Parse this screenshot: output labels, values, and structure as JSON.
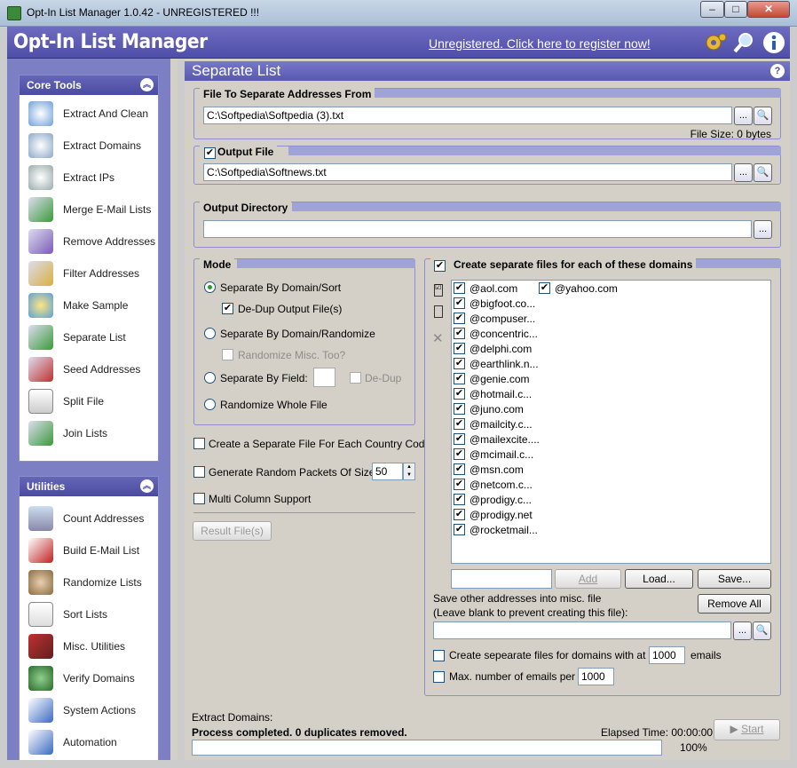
{
  "window": {
    "title": "Opt-In List Manager 1.0.42 - UNREGISTERED !!!",
    "min": "–",
    "max": "□",
    "close": "✕"
  },
  "banner": {
    "logo": "Opt-In List Manager",
    "register_link": "Unregistered. Click here to register now!"
  },
  "sidebar": {
    "core_tools": {
      "title": "Core Tools",
      "items": [
        "Extract And Clean",
        "Extract Domains",
        "Extract IPs",
        "Merge E-Mail Lists",
        "Remove Addresses",
        "Filter Addresses",
        "Make Sample",
        "Separate List",
        "Seed Addresses",
        "Split File",
        "Join Lists"
      ]
    },
    "utilities": {
      "title": "Utilities",
      "items": [
        "Count Addresses",
        "Build E-Mail List",
        "Randomize Lists",
        "Sort Lists",
        "Misc. Utilities",
        "Verify Domains",
        "System Actions",
        "Automation"
      ]
    }
  },
  "main": {
    "title": "Separate List",
    "help": "?",
    "file_group": {
      "title": "File To Separate Addresses From",
      "value": "C:\\Softpedia\\Softpedia (3).txt",
      "file_size": "File Size: 0 bytes"
    },
    "output_group": {
      "title": "Output File",
      "value": "C:\\Softpedia\\Softnews.txt"
    },
    "outdir_group": {
      "title": "Output Directory",
      "value": ""
    },
    "browse": "...",
    "mode": {
      "title": "Mode",
      "opt1": "Separate By Domain/Sort",
      "dedup": "De-Dup Output File(s)",
      "opt2": "Separate By Domain/Randomize",
      "randomize_misc": "Randomize Misc. Too?",
      "opt3": "Separate By Field:",
      "field_dedup": "De-Dup",
      "opt4": "Randomize Whole File"
    },
    "country_code": "Create a Separate File For Each Country Code",
    "random_packets": "Generate Random Packets Of Size",
    "packet_size": "50",
    "multi_column": "Multi Column Support",
    "result_button": "Result File(s)",
    "domains": {
      "title": "Create separate files for each of these domains",
      "list": [
        "@aol.com",
        "@bigfoot.co...",
        "@compuser...",
        "@concentric...",
        "@delphi.com",
        "@earthlink.n...",
        "@genie.com",
        "@hotmail.c...",
        "@juno.com",
        "@mailcity.c...",
        "@mailexcite....",
        "@mcimail.c...",
        "@msn.com",
        "@netcom.c...",
        "@prodigy.c...",
        "@prodigy.net",
        "@rocketmail..."
      ],
      "col2": [
        "@yahoo.com"
      ],
      "add": "Add",
      "load": "Load...",
      "save": "Save...",
      "remove_all": "Remove All",
      "misc_label1": "Save other addresses into misc. file",
      "misc_label2": "(Leave blank to prevent creating this file):",
      "at_least_label": "Create sepearate files for domains with at least",
      "at_least_value": "1000",
      "emails": "emails",
      "max_label": "Max. number of emails per file",
      "max_value": "1000"
    },
    "status": {
      "label": "Extract Domains:",
      "message": "Process completed. 0 duplicates removed.",
      "elapsed": "Elapsed Time:  00:00:00",
      "percent": "100%",
      "progress": 1.0,
      "start": "Start"
    }
  },
  "colors": {
    "banner": "#5c5bb3",
    "sidebar": "#7c7fc4",
    "accent": "#4a4aa0"
  }
}
